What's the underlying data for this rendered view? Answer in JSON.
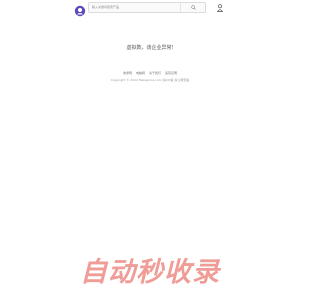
{
  "header": {
    "search": {
      "placeholder": "输入关键词搜索产品"
    }
  },
  "main": {
    "notice": "虚拟数，该企业异常!"
  },
  "footer": {
    "links": [
      "收录网",
      "电脑网",
      "关于我们",
      "运营证明"
    ],
    "copyright": "Copyright © 2022 Makeprice.com 渝ICP备 渝公网安备"
  },
  "banner": {
    "text": "自动秒收录"
  },
  "colors": {
    "accent": "#f09c97",
    "logo": "#5b4bbd"
  },
  "icons": {
    "logo": "purple-avatar-logo",
    "search": "search-icon",
    "user": "user-icon"
  }
}
